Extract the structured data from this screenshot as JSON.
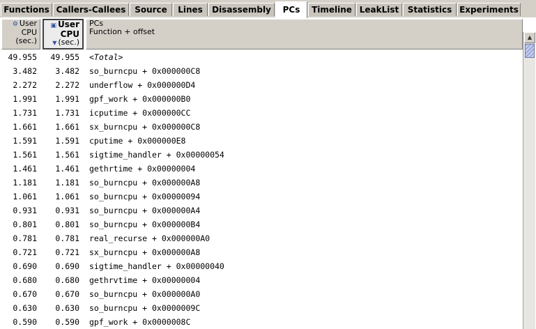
{
  "tabs": [
    {
      "label": "Functions",
      "active": false
    },
    {
      "label": "Callers-Callees",
      "active": false
    },
    {
      "label": "Source",
      "active": false
    },
    {
      "label": "Lines",
      "active": false
    },
    {
      "label": "Disassembly",
      "active": false
    },
    {
      "label": "PCs",
      "active": true
    },
    {
      "label": "Timeline",
      "active": false
    },
    {
      "label": "LeakList",
      "active": false
    },
    {
      "label": "Statistics",
      "active": false
    },
    {
      "label": "Experiments",
      "active": false
    }
  ],
  "columns": {
    "col1": {
      "line1": "User",
      "line2": "CPU",
      "line3": "(sec.)",
      "icon": "inclusive-icon"
    },
    "col2": {
      "line1": "User",
      "line2": "CPU",
      "line3": "(sec.)",
      "icon": "exclusive-icon",
      "sorted": true
    },
    "col3": {
      "line1": "PCs",
      "line2": "Function + offset"
    }
  },
  "rows": [
    {
      "v1": "49.955",
      "v2": "49.955",
      "name": "<Total>"
    },
    {
      "v1": "3.482",
      "v2": "3.482",
      "name": "so_burncpu + 0x000000C8"
    },
    {
      "v1": "2.272",
      "v2": "2.272",
      "name": "underflow + 0x000000D4"
    },
    {
      "v1": "1.991",
      "v2": "1.991",
      "name": "gpf_work + 0x000000B0"
    },
    {
      "v1": "1.731",
      "v2": "1.731",
      "name": "icputime + 0x000000CC"
    },
    {
      "v1": "1.661",
      "v2": "1.661",
      "name": "sx_burncpu + 0x000000C8"
    },
    {
      "v1": "1.591",
      "v2": "1.591",
      "name": "cputime + 0x000000E8"
    },
    {
      "v1": "1.561",
      "v2": "1.561",
      "name": "sigtime_handler + 0x00000054"
    },
    {
      "v1": "1.461",
      "v2": "1.461",
      "name": "gethrtime + 0x00000004"
    },
    {
      "v1": "1.181",
      "v2": "1.181",
      "name": "so_burncpu + 0x000000A8"
    },
    {
      "v1": "1.061",
      "v2": "1.061",
      "name": "so_burncpu + 0x00000094"
    },
    {
      "v1": "0.931",
      "v2": "0.931",
      "name": "so_burncpu + 0x000000A4"
    },
    {
      "v1": "0.801",
      "v2": "0.801",
      "name": "so_burncpu + 0x000000B4"
    },
    {
      "v1": "0.781",
      "v2": "0.781",
      "name": "real_recurse + 0x000000A0"
    },
    {
      "v1": "0.721",
      "v2": "0.721",
      "name": "sx_burncpu + 0x000000A8"
    },
    {
      "v1": "0.690",
      "v2": "0.690",
      "name": "sigtime_handler + 0x00000040"
    },
    {
      "v1": "0.680",
      "v2": "0.680",
      "name": "gethrvtime + 0x00000004"
    },
    {
      "v1": "0.670",
      "v2": "0.670",
      "name": "so_burncpu + 0x000000A0"
    },
    {
      "v1": "0.630",
      "v2": "0.630",
      "name": "so_burncpu + 0x0000009C"
    },
    {
      "v1": "0.590",
      "v2": "0.590",
      "name": "gpf_work + 0x0000008C"
    }
  ],
  "scrollbar": {
    "up_icon": "arrow-up-icon",
    "thumb_icon": "scroll-thumb"
  }
}
